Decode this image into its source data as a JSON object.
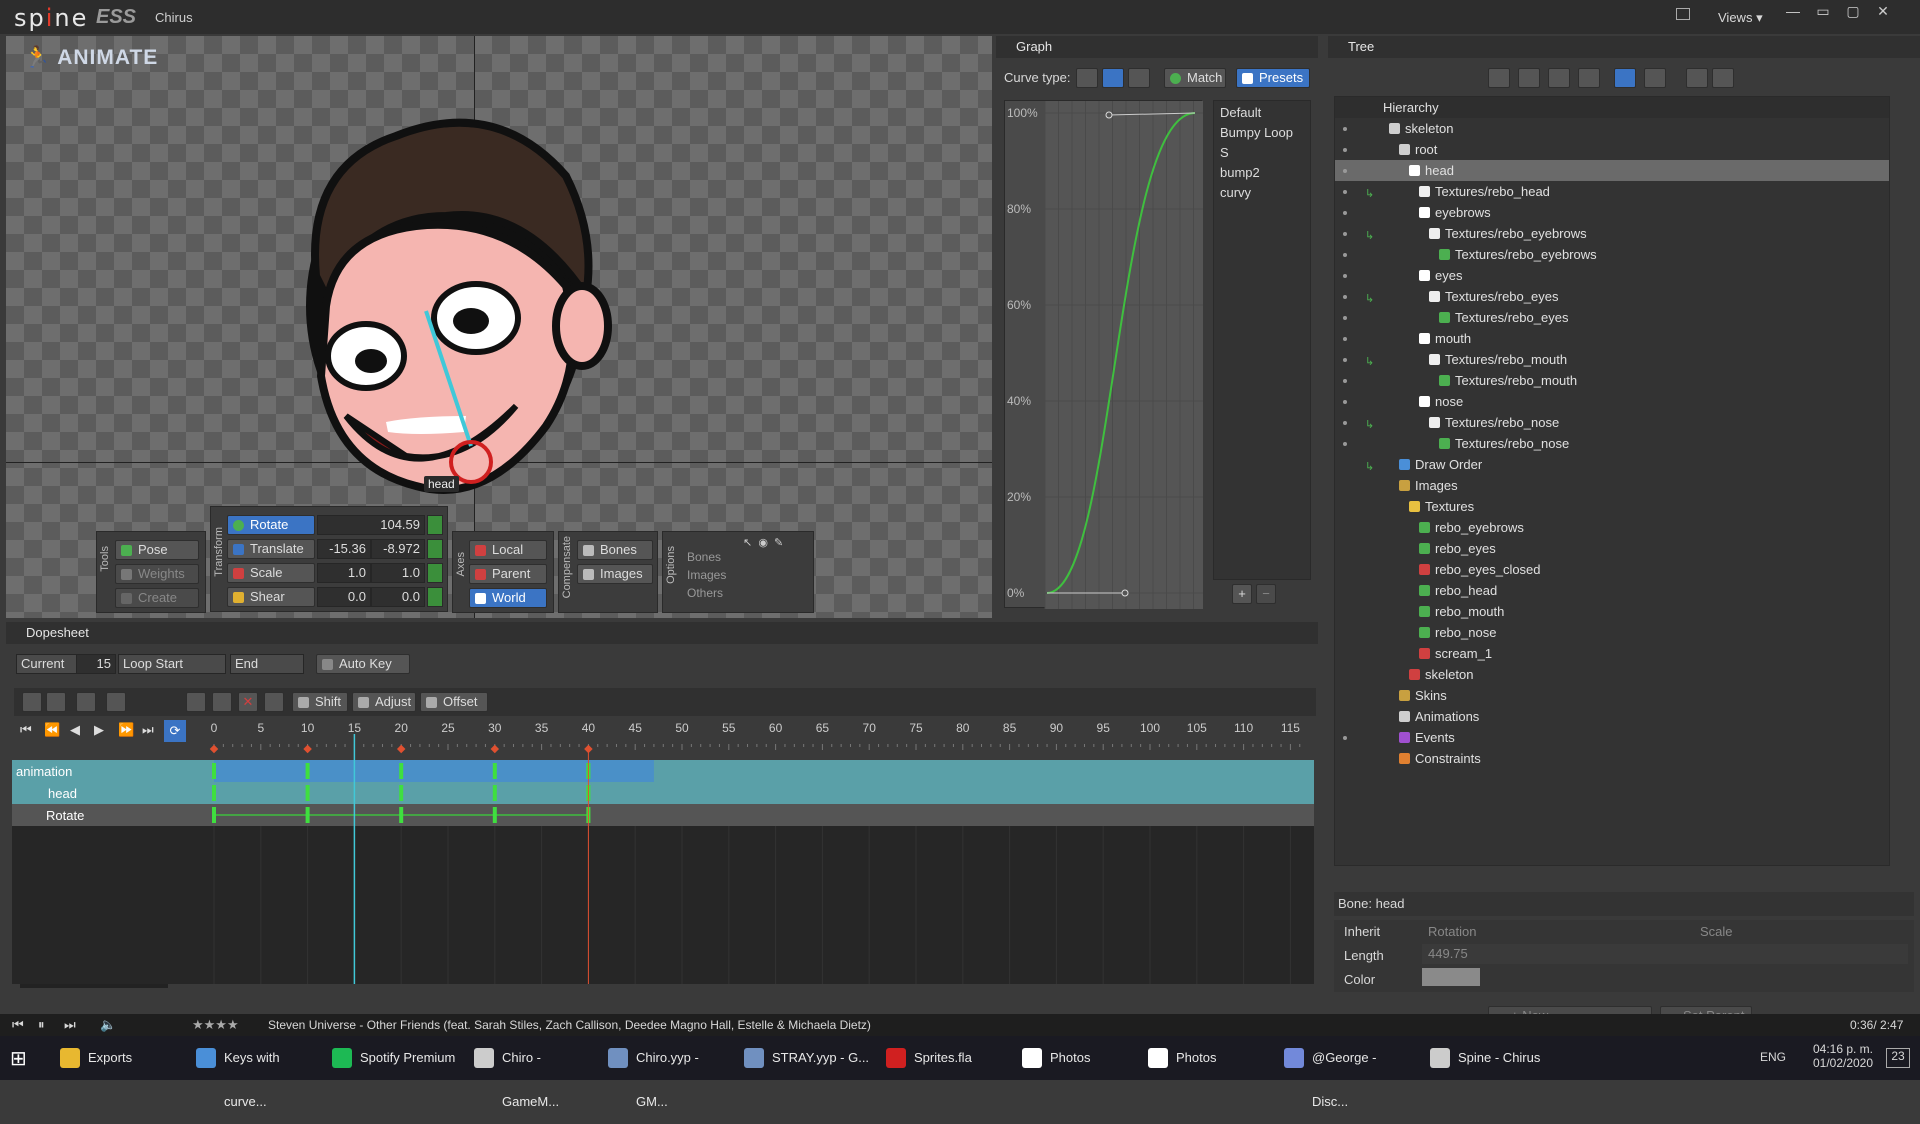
{
  "app": {
    "logo_pre": "sp",
    "logo_mid": "i",
    "logo_post": "ne",
    "edition": "ESS",
    "project": "Chirus",
    "views": "Views"
  },
  "viewport": {
    "mode": "ANIMATE",
    "bone_label": "head"
  },
  "tools": {
    "section": "Tools",
    "pose": "Pose",
    "weights": "Weights",
    "create": "Create"
  },
  "transform": {
    "section": "Transform",
    "rotate": {
      "label": "Rotate",
      "value": "104.59"
    },
    "translate": {
      "label": "Translate",
      "x": "-15.36",
      "y": "-8.972"
    },
    "scale": {
      "label": "Scale",
      "x": "1.0",
      "y": "1.0"
    },
    "shear": {
      "label": "Shear",
      "x": "0.0",
      "y": "0.0"
    }
  },
  "axes": {
    "section": "Axes",
    "local": "Local",
    "parent": "Parent",
    "world": "World"
  },
  "compensate": {
    "section": "Compensate",
    "bones": "Bones",
    "images": "Images"
  },
  "options": {
    "section": "Options",
    "bones": "Bones",
    "images": "Images",
    "others": "Others"
  },
  "graph": {
    "title": "Graph",
    "curve_type": "Curve type:",
    "match": "Match",
    "presets_btn": "Presets",
    "y_ticks": [
      "100%",
      "80%",
      "60%",
      "40%",
      "20%",
      "0%"
    ],
    "presets": [
      "Default",
      "Bumpy Loop",
      "S",
      "bump2",
      "curvy"
    ]
  },
  "tree": {
    "title": "Tree",
    "header": "Hierarchy",
    "rows": [
      {
        "label": "skeleton",
        "indent": 1,
        "color": "#cfcfcf",
        "dot": true
      },
      {
        "label": "root",
        "indent": 2,
        "color": "#cfcfcf",
        "dot": true
      },
      {
        "label": "head",
        "indent": 3,
        "color": "#ffffff",
        "dot": true,
        "sel": true
      },
      {
        "label": "Textures/rebo_head",
        "indent": 4,
        "color": "#eeeeee",
        "dot": true,
        "key": true
      },
      {
        "label": "eyebrows",
        "indent": 4,
        "color": "#ffffff",
        "dot": true
      },
      {
        "label": "Textures/rebo_eyebrows",
        "indent": 5,
        "color": "#eeeeee",
        "dot": true,
        "key": true
      },
      {
        "label": "Textures/rebo_eyebrows",
        "indent": 6,
        "color": "#4caf50",
        "dot": true
      },
      {
        "label": "eyes",
        "indent": 4,
        "color": "#ffffff",
        "dot": true
      },
      {
        "label": "Textures/rebo_eyes",
        "indent": 5,
        "color": "#eeeeee",
        "dot": true,
        "key": true
      },
      {
        "label": "Textures/rebo_eyes",
        "indent": 6,
        "color": "#4caf50",
        "dot": true
      },
      {
        "label": "mouth",
        "indent": 4,
        "color": "#ffffff",
        "dot": true
      },
      {
        "label": "Textures/rebo_mouth",
        "indent": 5,
        "color": "#eeeeee",
        "dot": true,
        "key": true
      },
      {
        "label": "Textures/rebo_mouth",
        "indent": 6,
        "color": "#4caf50",
        "dot": true
      },
      {
        "label": "nose",
        "indent": 4,
        "color": "#ffffff",
        "dot": true
      },
      {
        "label": "Textures/rebo_nose",
        "indent": 5,
        "color": "#eeeeee",
        "dot": true,
        "key": true
      },
      {
        "label": "Textures/rebo_nose",
        "indent": 6,
        "color": "#4caf50",
        "dot": true
      },
      {
        "label": "Draw Order",
        "indent": 2,
        "color": "#4a8fd8",
        "dot": false,
        "key": true
      },
      {
        "label": "Images",
        "indent": 2,
        "color": "#c8a040",
        "dot": false
      },
      {
        "label": "Textures",
        "indent": 3,
        "color": "#e8c040",
        "dot": false
      },
      {
        "label": "rebo_eyebrows",
        "indent": 4,
        "color": "#4caf50",
        "dot": false
      },
      {
        "label": "rebo_eyes",
        "indent": 4,
        "color": "#4caf50",
        "dot": false
      },
      {
        "label": "rebo_eyes_closed",
        "indent": 4,
        "color": "#d04040",
        "dot": false
      },
      {
        "label": "rebo_head",
        "indent": 4,
        "color": "#4caf50",
        "dot": false
      },
      {
        "label": "rebo_mouth",
        "indent": 4,
        "color": "#4caf50",
        "dot": false
      },
      {
        "label": "rebo_nose",
        "indent": 4,
        "color": "#4caf50",
        "dot": false
      },
      {
        "label": "scream_1",
        "indent": 4,
        "color": "#d04040",
        "dot": false
      },
      {
        "label": "skeleton",
        "indent": 3,
        "color": "#d04040",
        "dot": false
      },
      {
        "label": "Skins",
        "indent": 2,
        "color": "#c8a040",
        "dot": false
      },
      {
        "label": "Animations",
        "indent": 2,
        "color": "#cfcfcf",
        "dot": false
      },
      {
        "label": "Events",
        "indent": 2,
        "color": "#a050d0",
        "dot": true
      },
      {
        "label": "Constraints",
        "indent": 2,
        "color": "#e08030",
        "dot": false
      }
    ],
    "bone_title": "Bone: head",
    "inherit": "Inherit",
    "rotation": "Rotation",
    "scale": "Scale",
    "length": "Length",
    "length_val": "449.75",
    "color": "Color",
    "new_btn": "New...",
    "set_parent": "Set Parent"
  },
  "dopesheet": {
    "title": "Dopesheet",
    "current_label": "Current",
    "current": "15",
    "loop_start": "Loop Start",
    "end": "End",
    "auto_key": "Auto Key",
    "shift": "Shift",
    "adjust": "Adjust",
    "offset": "Offset",
    "frames": [
      "0",
      "5",
      "10",
      "15",
      "20",
      "25",
      "30",
      "35",
      "40",
      "45",
      "50",
      "55",
      "60",
      "65",
      "70",
      "75",
      "80",
      "85",
      "90",
      "95",
      "100",
      "105",
      "110",
      "115"
    ],
    "keys": [
      0,
      10,
      20,
      30,
      40
    ],
    "current_frame": 15,
    "tracks": [
      "animation",
      "head",
      "Rotate"
    ]
  },
  "music": {
    "title": "Steven Universe - Other Friends (feat. Sarah Stiles, Zach Callison, Deedee Magno Hall, Estelle & Michaela Dietz)",
    "time": "0:36/ 2:47"
  },
  "taskbar": {
    "items": [
      {
        "label": "Exports",
        "color": "#e8b830"
      },
      {
        "label": "Keys with curve...",
        "color": "#4a8fd8"
      },
      {
        "label": "Spotify Premium",
        "color": "#1db954"
      },
      {
        "label": "Chiro - GameM...",
        "color": "#cccccc"
      },
      {
        "label": "Chiro.yyp - GM...",
        "color": "#7090c0"
      },
      {
        "label": "STRAY.yyp - G...",
        "color": "#7090c0"
      },
      {
        "label": "Sprites.fla",
        "color": "#d02020"
      },
      {
        "label": "Photos",
        "color": "#ffffff"
      },
      {
        "label": "Photos",
        "color": "#ffffff"
      },
      {
        "label": "@George - Disc...",
        "color": "#7289da"
      },
      {
        "label": "Spine - Chirus",
        "color": "#cccccc"
      }
    ],
    "lang": "ENG",
    "time": "04:16 p. m.",
    "date": "01/02/2020",
    "notif": "23"
  }
}
